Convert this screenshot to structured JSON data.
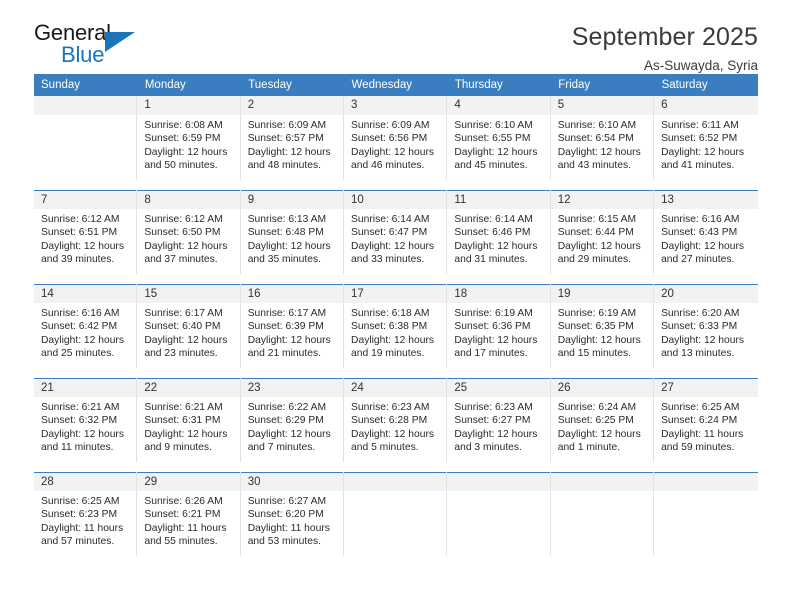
{
  "logo": {
    "primary_text": "General",
    "secondary_text": "Blue",
    "triangle_icon": "triangle-icon",
    "accent_color": "#1b75bb"
  },
  "header": {
    "title": "September 2025",
    "subtitle": "As-Suwayda, Syria"
  },
  "theme": {
    "header_background": "#3b7ebf",
    "date_cell_background": "#f2f2f2",
    "grid_line": "#e3e3e3",
    "text": "#2b2b2b"
  },
  "calendar": {
    "columns": [
      "Sunday",
      "Monday",
      "Tuesday",
      "Wednesday",
      "Thursday",
      "Friday",
      "Saturday"
    ],
    "labels": {
      "sunrise": "Sunrise:",
      "sunset": "Sunset:",
      "daylight": "Daylight:"
    },
    "weeks": [
      [
        {
          "day": ""
        },
        {
          "day": "1",
          "sunrise": "Sunrise: 6:08 AM",
          "sunset": "Sunset: 6:59 PM",
          "daylight_1": "Daylight: 12 hours",
          "daylight_2": "and 50 minutes."
        },
        {
          "day": "2",
          "sunrise": "Sunrise: 6:09 AM",
          "sunset": "Sunset: 6:57 PM",
          "daylight_1": "Daylight: 12 hours",
          "daylight_2": "and 48 minutes."
        },
        {
          "day": "3",
          "sunrise": "Sunrise: 6:09 AM",
          "sunset": "Sunset: 6:56 PM",
          "daylight_1": "Daylight: 12 hours",
          "daylight_2": "and 46 minutes."
        },
        {
          "day": "4",
          "sunrise": "Sunrise: 6:10 AM",
          "sunset": "Sunset: 6:55 PM",
          "daylight_1": "Daylight: 12 hours",
          "daylight_2": "and 45 minutes."
        },
        {
          "day": "5",
          "sunrise": "Sunrise: 6:10 AM",
          "sunset": "Sunset: 6:54 PM",
          "daylight_1": "Daylight: 12 hours",
          "daylight_2": "and 43 minutes."
        },
        {
          "day": "6",
          "sunrise": "Sunrise: 6:11 AM",
          "sunset": "Sunset: 6:52 PM",
          "daylight_1": "Daylight: 12 hours",
          "daylight_2": "and 41 minutes."
        }
      ],
      [
        {
          "day": "7",
          "sunrise": "Sunrise: 6:12 AM",
          "sunset": "Sunset: 6:51 PM",
          "daylight_1": "Daylight: 12 hours",
          "daylight_2": "and 39 minutes."
        },
        {
          "day": "8",
          "sunrise": "Sunrise: 6:12 AM",
          "sunset": "Sunset: 6:50 PM",
          "daylight_1": "Daylight: 12 hours",
          "daylight_2": "and 37 minutes."
        },
        {
          "day": "9",
          "sunrise": "Sunrise: 6:13 AM",
          "sunset": "Sunset: 6:48 PM",
          "daylight_1": "Daylight: 12 hours",
          "daylight_2": "and 35 minutes."
        },
        {
          "day": "10",
          "sunrise": "Sunrise: 6:14 AM",
          "sunset": "Sunset: 6:47 PM",
          "daylight_1": "Daylight: 12 hours",
          "daylight_2": "and 33 minutes."
        },
        {
          "day": "11",
          "sunrise": "Sunrise: 6:14 AM",
          "sunset": "Sunset: 6:46 PM",
          "daylight_1": "Daylight: 12 hours",
          "daylight_2": "and 31 minutes."
        },
        {
          "day": "12",
          "sunrise": "Sunrise: 6:15 AM",
          "sunset": "Sunset: 6:44 PM",
          "daylight_1": "Daylight: 12 hours",
          "daylight_2": "and 29 minutes."
        },
        {
          "day": "13",
          "sunrise": "Sunrise: 6:16 AM",
          "sunset": "Sunset: 6:43 PM",
          "daylight_1": "Daylight: 12 hours",
          "daylight_2": "and 27 minutes."
        }
      ],
      [
        {
          "day": "14",
          "sunrise": "Sunrise: 6:16 AM",
          "sunset": "Sunset: 6:42 PM",
          "daylight_1": "Daylight: 12 hours",
          "daylight_2": "and 25 minutes."
        },
        {
          "day": "15",
          "sunrise": "Sunrise: 6:17 AM",
          "sunset": "Sunset: 6:40 PM",
          "daylight_1": "Daylight: 12 hours",
          "daylight_2": "and 23 minutes."
        },
        {
          "day": "16",
          "sunrise": "Sunrise: 6:17 AM",
          "sunset": "Sunset: 6:39 PM",
          "daylight_1": "Daylight: 12 hours",
          "daylight_2": "and 21 minutes."
        },
        {
          "day": "17",
          "sunrise": "Sunrise: 6:18 AM",
          "sunset": "Sunset: 6:38 PM",
          "daylight_1": "Daylight: 12 hours",
          "daylight_2": "and 19 minutes."
        },
        {
          "day": "18",
          "sunrise": "Sunrise: 6:19 AM",
          "sunset": "Sunset: 6:36 PM",
          "daylight_1": "Daylight: 12 hours",
          "daylight_2": "and 17 minutes."
        },
        {
          "day": "19",
          "sunrise": "Sunrise: 6:19 AM",
          "sunset": "Sunset: 6:35 PM",
          "daylight_1": "Daylight: 12 hours",
          "daylight_2": "and 15 minutes."
        },
        {
          "day": "20",
          "sunrise": "Sunrise: 6:20 AM",
          "sunset": "Sunset: 6:33 PM",
          "daylight_1": "Daylight: 12 hours",
          "daylight_2": "and 13 minutes."
        }
      ],
      [
        {
          "day": "21",
          "sunrise": "Sunrise: 6:21 AM",
          "sunset": "Sunset: 6:32 PM",
          "daylight_1": "Daylight: 12 hours",
          "daylight_2": "and 11 minutes."
        },
        {
          "day": "22",
          "sunrise": "Sunrise: 6:21 AM",
          "sunset": "Sunset: 6:31 PM",
          "daylight_1": "Daylight: 12 hours",
          "daylight_2": "and 9 minutes."
        },
        {
          "day": "23",
          "sunrise": "Sunrise: 6:22 AM",
          "sunset": "Sunset: 6:29 PM",
          "daylight_1": "Daylight: 12 hours",
          "daylight_2": "and 7 minutes."
        },
        {
          "day": "24",
          "sunrise": "Sunrise: 6:23 AM",
          "sunset": "Sunset: 6:28 PM",
          "daylight_1": "Daylight: 12 hours",
          "daylight_2": "and 5 minutes."
        },
        {
          "day": "25",
          "sunrise": "Sunrise: 6:23 AM",
          "sunset": "Sunset: 6:27 PM",
          "daylight_1": "Daylight: 12 hours",
          "daylight_2": "and 3 minutes."
        },
        {
          "day": "26",
          "sunrise": "Sunrise: 6:24 AM",
          "sunset": "Sunset: 6:25 PM",
          "daylight_1": "Daylight: 12 hours",
          "daylight_2": "and 1 minute."
        },
        {
          "day": "27",
          "sunrise": "Sunrise: 6:25 AM",
          "sunset": "Sunset: 6:24 PM",
          "daylight_1": "Daylight: 11 hours",
          "daylight_2": "and 59 minutes."
        }
      ],
      [
        {
          "day": "28",
          "sunrise": "Sunrise: 6:25 AM",
          "sunset": "Sunset: 6:23 PM",
          "daylight_1": "Daylight: 11 hours",
          "daylight_2": "and 57 minutes."
        },
        {
          "day": "29",
          "sunrise": "Sunrise: 6:26 AM",
          "sunset": "Sunset: 6:21 PM",
          "daylight_1": "Daylight: 11 hours",
          "daylight_2": "and 55 minutes."
        },
        {
          "day": "30",
          "sunrise": "Sunrise: 6:27 AM",
          "sunset": "Sunset: 6:20 PM",
          "daylight_1": "Daylight: 11 hours",
          "daylight_2": "and 53 minutes."
        },
        {
          "day": ""
        },
        {
          "day": ""
        },
        {
          "day": ""
        },
        {
          "day": ""
        }
      ]
    ]
  }
}
